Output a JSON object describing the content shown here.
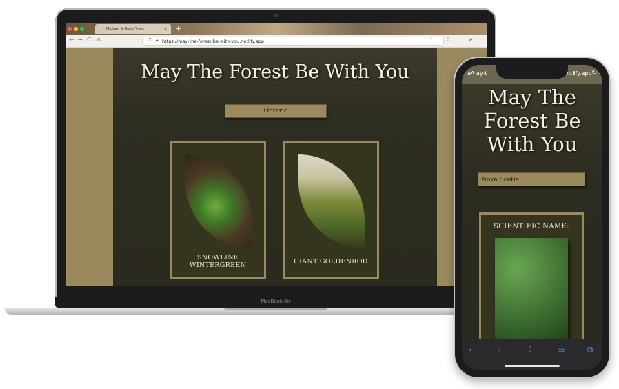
{
  "browser": {
    "tab_title": "Michael & Gea's Trees",
    "tab_close": "×",
    "new_tab": "+",
    "back_icon": "←",
    "forward_icon": "→",
    "reload_icon": "C",
    "home_icon": "⌂",
    "url": "https://may-the-forest-be-with-you.netlify.app",
    "menu_icon": "···",
    "bookmark_icon": "☆",
    "overflow_icon": "»"
  },
  "desktop_site": {
    "title": "May The Forest Be With You",
    "province_select": "Ontario",
    "cards": [
      {
        "name": "SNOWLINE WINTERGREEN"
      },
      {
        "name": "GIANT GOLDENROD"
      }
    ]
  },
  "laptop": {
    "label": "MacBook Air"
  },
  "phone": {
    "url_start": "aA  ay-t",
    "url_end": "ntlify.app",
    "reload_icon": "↻",
    "site_title": "May The Forest Be With You",
    "province_select": "Nova Scotia",
    "card_heading": "SCIENTIFIC NAME:",
    "nav": {
      "back": "‹",
      "forward": "›",
      "share": "⇪",
      "bookmarks": "▭",
      "tabs": "⧉"
    }
  },
  "colors": {
    "tan": "#9a8a5e",
    "forest_dark": "#2c2b20",
    "cream": "#f5f0e1"
  }
}
